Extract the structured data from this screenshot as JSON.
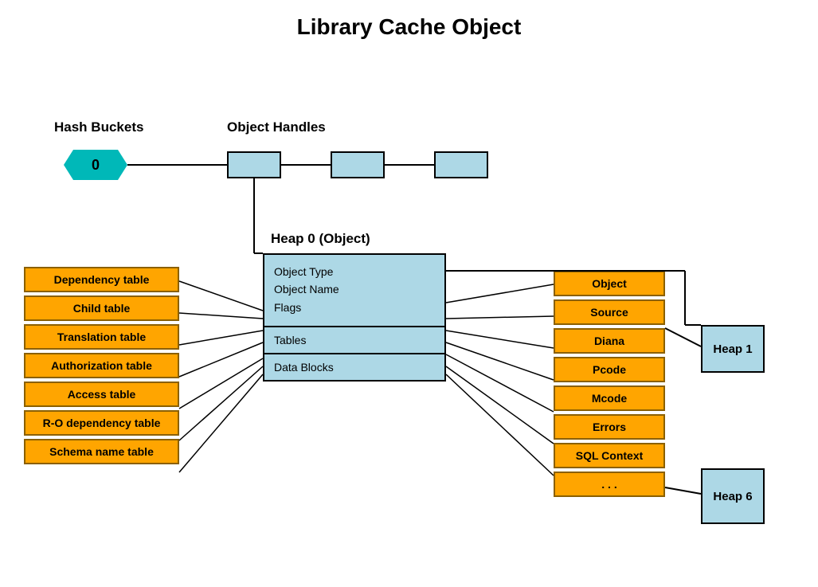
{
  "title": "Library Cache Object",
  "labels": {
    "hash_buckets": "Hash Buckets",
    "object_handles": "Object Handles",
    "heap0": "Heap 0 (Object)",
    "heap1": "Heap 1",
    "heap6": "Heap 6"
  },
  "hash_bucket": {
    "value": "0"
  },
  "heap0_fields": {
    "top": [
      "Object Type",
      "Object Name",
      "Flags"
    ],
    "middle": "Tables",
    "bottom": "Data Blocks"
  },
  "left_tables": [
    "Dependency table",
    "Child table",
    "Translation table",
    "Authorization table",
    "Access table",
    "R-O dependency table",
    "Schema name table"
  ],
  "right_items": [
    "Object",
    "Source",
    "Diana",
    "Pcode",
    "Mcode",
    "Errors",
    "SQL Context",
    "..."
  ]
}
